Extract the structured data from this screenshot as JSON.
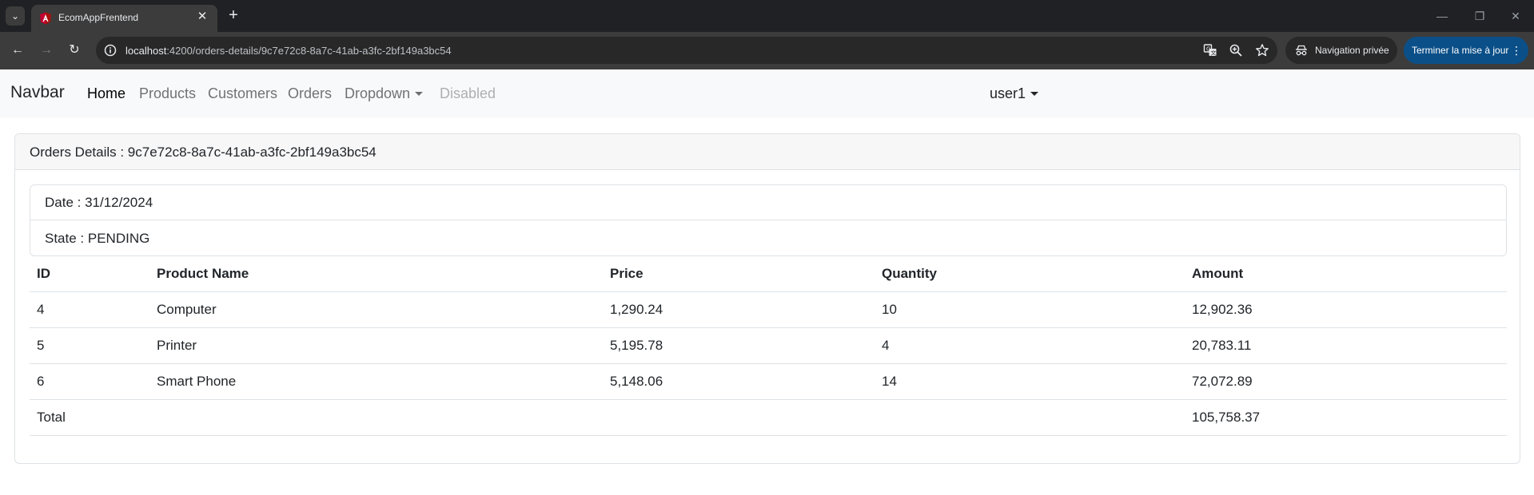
{
  "browser": {
    "tab_title": "EcomAppFrentend",
    "url_host": "localhost",
    "url_rest": ":4200/orders-details/9c7e72c8-8a7c-41ab-a3fc-2bf149a3bc54",
    "private_label": "Navigation privée",
    "update_label": "Terminer la mise à jour"
  },
  "navbar": {
    "brand": "Navbar",
    "links": [
      "Home",
      "Products",
      "Customers",
      "Orders",
      "Dropdown",
      "Disabled"
    ],
    "user": "user1"
  },
  "order": {
    "header": "Orders Details : 9c7e72c8-8a7c-41ab-a3fc-2bf149a3bc54",
    "date": "Date : 31/12/2024",
    "state": "State : PENDING"
  },
  "table": {
    "columns": [
      "ID",
      "Product Name",
      "Price",
      "Quantity",
      "Amount"
    ],
    "rows": [
      [
        "4",
        "Computer",
        "1,290.24",
        "10",
        "12,902.36"
      ],
      [
        "5",
        "Printer",
        "5,195.78",
        "4",
        "20,783.11"
      ],
      [
        "6",
        "Smart Phone",
        "5,148.06",
        "14",
        "72,072.89"
      ]
    ],
    "total_label": "Total",
    "total_value": "105,758.37"
  }
}
